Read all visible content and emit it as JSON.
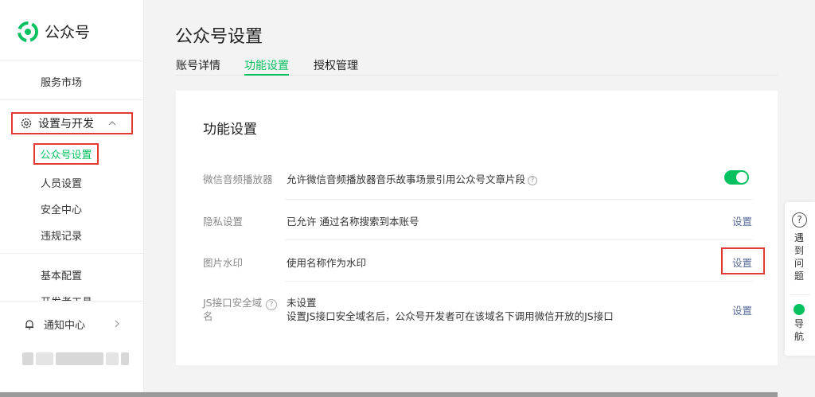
{
  "brand": {
    "name": "公众号",
    "accent": "#07c160"
  },
  "sidebar": {
    "items_top": [
      {
        "label": "服务市场"
      }
    ],
    "group": {
      "label": "设置与开发",
      "icon": "gear-icon",
      "expanded": true
    },
    "sub_items": [
      {
        "label": "公众号设置",
        "active": true
      },
      {
        "label": "人员设置"
      },
      {
        "label": "安全中心"
      },
      {
        "label": "违规记录"
      }
    ],
    "items_bottom": [
      {
        "label": "基本配置"
      },
      {
        "label": "开发者工具"
      }
    ],
    "notify": {
      "label": "通知中心",
      "icon": "bell-icon"
    }
  },
  "page": {
    "title": "公众号设置",
    "tabs": [
      {
        "label": "账号详情"
      },
      {
        "label": "功能设置",
        "active": true
      },
      {
        "label": "授权管理"
      }
    ]
  },
  "card": {
    "title": "功能设置",
    "rows": [
      {
        "label": "微信音频播放器",
        "value": "允许微信音频播放器音乐故事场景引用公众号文章片段",
        "help": "?",
        "control": "toggle",
        "toggle_on": true
      },
      {
        "label": "隐私设置",
        "value": "已允许 通过名称搜索到本账号",
        "action": "设置"
      },
      {
        "label": "图片水印",
        "value": "使用名称作为水印",
        "action": "设置"
      },
      {
        "label_line1": "JS接口安全域",
        "label_line2": "名",
        "help": "?",
        "value": "未设置",
        "value_line2": "设置JS接口安全域名后，公众号开发者可在该域名下调用微信开放的JS接口",
        "action": "设置"
      }
    ]
  },
  "float_panel": {
    "help_icon": "?",
    "help_text": "遇到问题",
    "nav_text": "导航"
  }
}
